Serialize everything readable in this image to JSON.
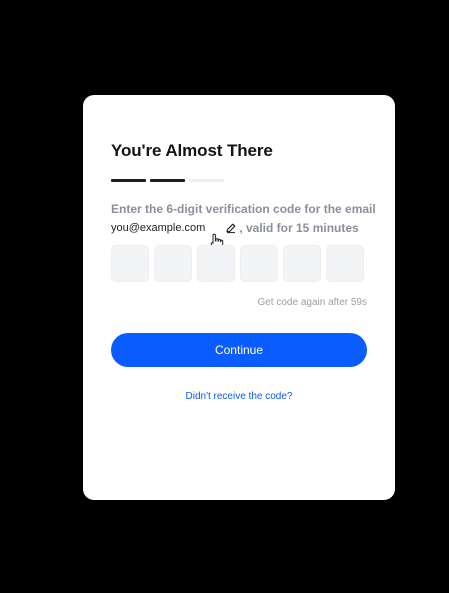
{
  "card": {
    "title": "You're Almost There",
    "progress": {
      "total_steps": 3,
      "completed_steps": 2
    },
    "description": {
      "line1": "Enter the 6-digit verification code for the email",
      "email": "you@example.com",
      "suffix": ", valid for 15 minutes"
    },
    "code_inputs": [
      "",
      "",
      "",
      "",
      "",
      ""
    ],
    "resend_timer": "Get code again after 59s",
    "continue_label": "Continue",
    "no_code_link": "Didn't receive the code?"
  },
  "colors": {
    "background": "#000000",
    "card": "#ffffff",
    "primary": "#0a5cff",
    "title": "#111418",
    "muted": "#8a909a",
    "input_bg": "#f3f4f6"
  },
  "icons": {
    "edit": "pencil-icon",
    "cursor": "hand-pointer-icon"
  }
}
